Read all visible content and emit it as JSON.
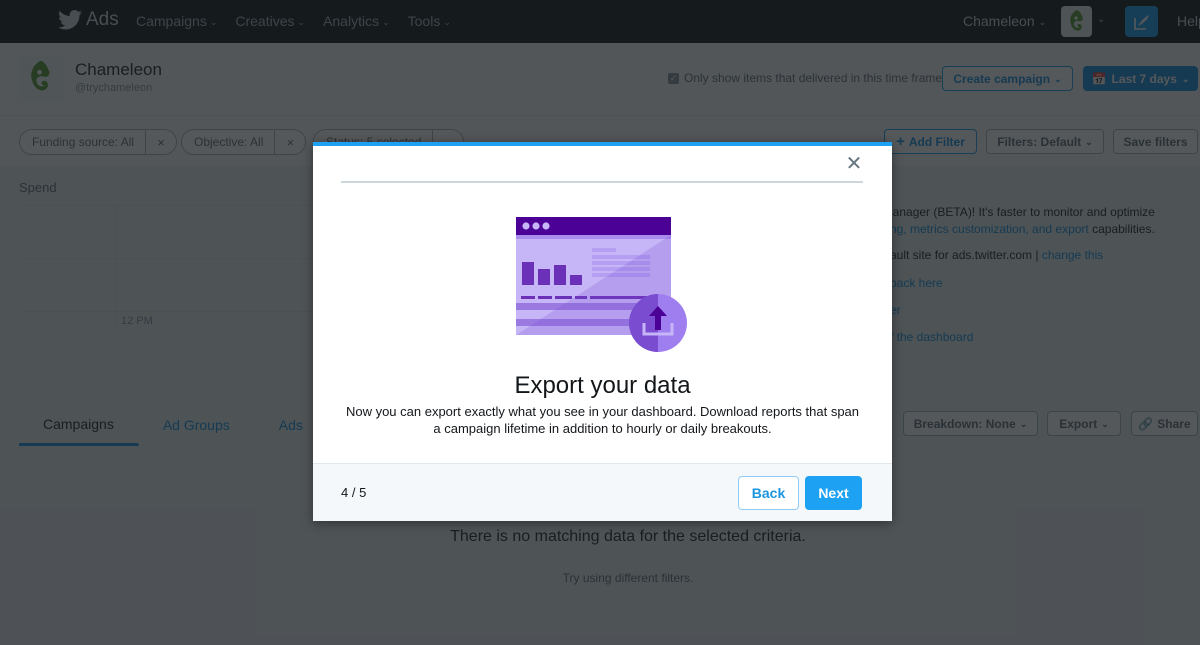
{
  "topnav": {
    "brand": "Ads",
    "items": [
      {
        "label": "Campaigns"
      },
      {
        "label": "Creatives"
      },
      {
        "label": "Analytics"
      },
      {
        "label": "Tools"
      }
    ],
    "account_switch": "Chameleon",
    "help": "Help",
    "icons": {
      "logo": "twitter-bird-icon",
      "compose": "compose-icon",
      "chevron": "chevron-down-icon"
    }
  },
  "header": {
    "account_name": "Chameleon",
    "account_handle": "@trychameleon",
    "delivered_checkbox_label": "Only show items that delivered in this time frame",
    "delivered_checked": true,
    "create_campaign": "Create campaign",
    "date_range": "Last 7 days"
  },
  "filters": {
    "pills": [
      {
        "label": "Funding source: All"
      },
      {
        "label": "Objective: All"
      },
      {
        "label": "Status: 5 selected"
      }
    ],
    "add_filter": "Add Filter",
    "filters_default": "Filters: Default",
    "save_filters": "Save filters"
  },
  "chart": {
    "title": "Spend",
    "tick_label": "12 PM"
  },
  "info_panel": {
    "line1": "lanager (BETA)! It's faster to monitor and optimize",
    "line2_link": "ng, metrics customization, and export",
    "line2_rest": " capabilities.",
    "line3_text": "ault site for ads.twitter.com |",
    "line3_link": "change this",
    "line4_link": "back here",
    "line5_link": "er",
    "line6_link": "f the dashboard"
  },
  "tabs": [
    {
      "label": "Campaigns",
      "active": true
    },
    {
      "label": "Ad Groups",
      "active": false
    },
    {
      "label": "Ads",
      "active": false
    }
  ],
  "table_actions": {
    "breakdown": "Breakdown: None",
    "export": "Export",
    "share": "Share"
  },
  "empty_state": {
    "title": "There is no matching data for the selected criteria.",
    "subtitle": "Try using different filters."
  },
  "modal": {
    "title": "Export your data",
    "body": "Now you can export exactly what you see in your dashboard. Download reports that span a campaign lifetime in addition to hourly or daily breakouts.",
    "step": "4 / 5",
    "back": "Back",
    "next": "Next",
    "illustration": "export-dashboard-illustration",
    "accent_color": "#1da1f2",
    "illustration_color": "#4a0099"
  }
}
